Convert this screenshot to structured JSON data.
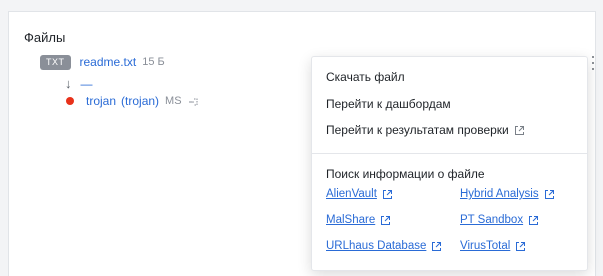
{
  "section": {
    "title": "Файлы"
  },
  "file": {
    "type_badge": "TXT",
    "name": "readme.txt",
    "size": "15 Б"
  },
  "child": {
    "arrow": "↓",
    "name": "—"
  },
  "threat": {
    "name": "trojan",
    "family": "(trojan)",
    "vendor": "MS"
  },
  "menu": {
    "items": [
      {
        "label": "Скачать файл"
      },
      {
        "label": "Перейти к дашбордам"
      },
      {
        "label": "Перейти к результатам проверки"
      }
    ],
    "lookup_title": "Поиск информации о файле",
    "services": [
      {
        "label": "AlienVault"
      },
      {
        "label": "Hybrid Analysis"
      },
      {
        "label": "MalShare"
      },
      {
        "label": "PT Sandbox"
      },
      {
        "label": "URLhaus Database"
      },
      {
        "label": "VirusTotal"
      }
    ]
  },
  "colors": {
    "link": "#2a6bd6",
    "badge_bg": "#8a8f98",
    "threat_dot": "#e8311a"
  },
  "icons": {
    "more": "kebab-menu-icon",
    "external": "external-link-icon",
    "copy": "copy-icon",
    "arrow": "arrow-down-icon"
  }
}
